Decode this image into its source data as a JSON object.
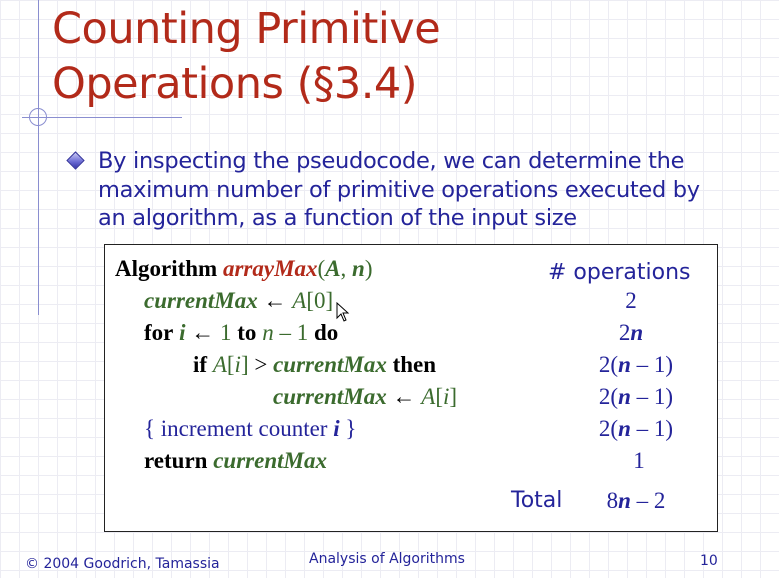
{
  "slide": {
    "title_line1": "Counting Primitive",
    "title_line2": "Operations (§3.4)",
    "bullet": "By inspecting the pseudocode, we can determine the maximum number of primitive operations executed by an algorithm, as a function of the input size"
  },
  "algorithm": {
    "kw_algorithm": "Algorithm",
    "fn_name": "arrayMax",
    "var_A": "A",
    "var_n": "n",
    "var_i": "i",
    "var_currentMax": "currentMax",
    "kw_for": "for",
    "kw_to": "to",
    "kw_do": "do",
    "kw_if": "if",
    "kw_then": "then",
    "kw_return": "return",
    "comment_text": "increment counter",
    "num_0": "0",
    "num_1": "1"
  },
  "operations": {
    "header": "# operations",
    "counts": [
      "2",
      "2n",
      "2(n – 1)",
      "2(n – 1)",
      "2(n – 1)",
      "1"
    ],
    "total_label": "Total",
    "total_value": "8n – 2"
  },
  "footer": {
    "copyright": "© 2004 Goodrich, Tamassia",
    "center": "Analysis of Algorithms",
    "page_number": "10"
  },
  "colors": {
    "title": "#b22a1a",
    "body_text": "#24249a",
    "variable": "#3b6b2e",
    "keyword": "#000000"
  },
  "icons": {
    "bullet": "diamond-bullet-icon",
    "cursor": "mouse-pointer-icon"
  }
}
